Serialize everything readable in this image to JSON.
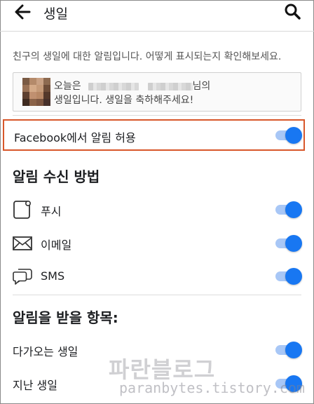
{
  "header": {
    "title": "생일"
  },
  "description": "친구의 생일에 대한 알림입니다. 어떻게 표시되는지 확인해보세요.",
  "notice": {
    "prefix": "오늘은",
    "suffix_line1": "님의",
    "line2": "생일입니다. 생일을 축하해주세요!"
  },
  "facebook_toggle": {
    "label": "Facebook에서 알림 허용",
    "on": true
  },
  "receive_section": {
    "heading": "알림 수신 방법",
    "items": [
      {
        "label": "푸시",
        "icon": "push-icon",
        "on": true
      },
      {
        "label": "이메일",
        "icon": "email-icon",
        "on": true
      },
      {
        "label": "SMS",
        "icon": "sms-icon",
        "on": true
      }
    ]
  },
  "topics_section": {
    "heading": "알림을 받을 항목:",
    "items": [
      {
        "label": "다가오는 생일",
        "on": true
      },
      {
        "label": "지난 생일",
        "on": true
      }
    ]
  },
  "watermark": {
    "brand": "파란블로그",
    "url": "paranbytes.tistory.com"
  },
  "colors": {
    "accent": "#1877f2",
    "toggle_track": "#a8c7f6",
    "highlight_border": "#d8572a"
  }
}
